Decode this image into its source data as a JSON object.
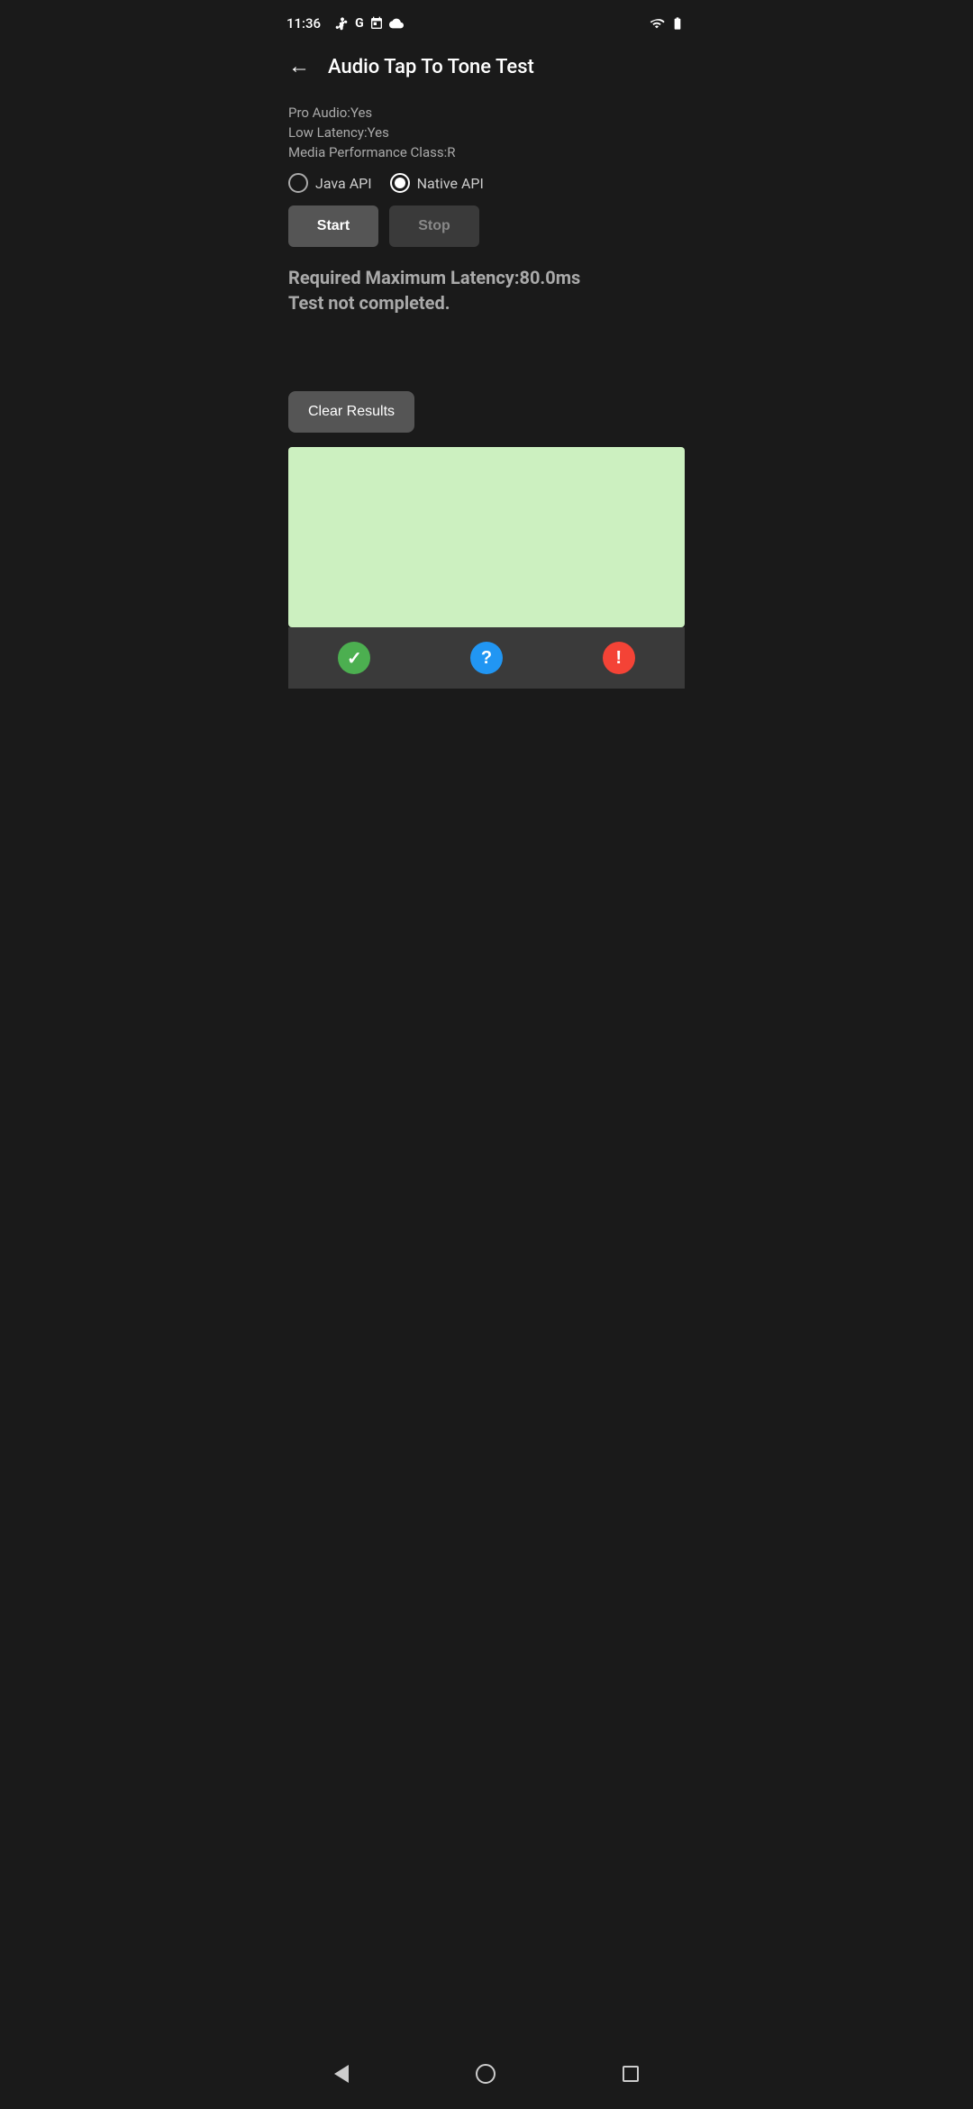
{
  "statusBar": {
    "time": "11:36",
    "iconsLeft": [
      "fan-icon",
      "google-icon",
      "calendar-icon",
      "cloud-icon"
    ],
    "wifi": "wifi-icon",
    "battery": "battery-icon"
  },
  "header": {
    "back_label": "←",
    "title": "Audio Tap To Tone Test"
  },
  "info": {
    "pro_audio": "Pro Audio:Yes",
    "low_latency": "Low Latency:Yes",
    "media_perf": "Media Performance Class:R"
  },
  "radioGroup": {
    "options": [
      {
        "id": "java",
        "label": "Java API",
        "selected": false
      },
      {
        "id": "native",
        "label": "Native API",
        "selected": true
      }
    ]
  },
  "buttons": {
    "start_label": "Start",
    "stop_label": "Stop"
  },
  "result": {
    "line1": "Required Maximum Latency:80.0ms",
    "line2": "Test not completed."
  },
  "clearResults": {
    "label": "Clear Results"
  },
  "bottomIcons": {
    "check": "✓",
    "question": "?",
    "exclamation": "!"
  },
  "navBar": {
    "back": "back-nav",
    "home": "home-nav",
    "recents": "recents-nav"
  }
}
